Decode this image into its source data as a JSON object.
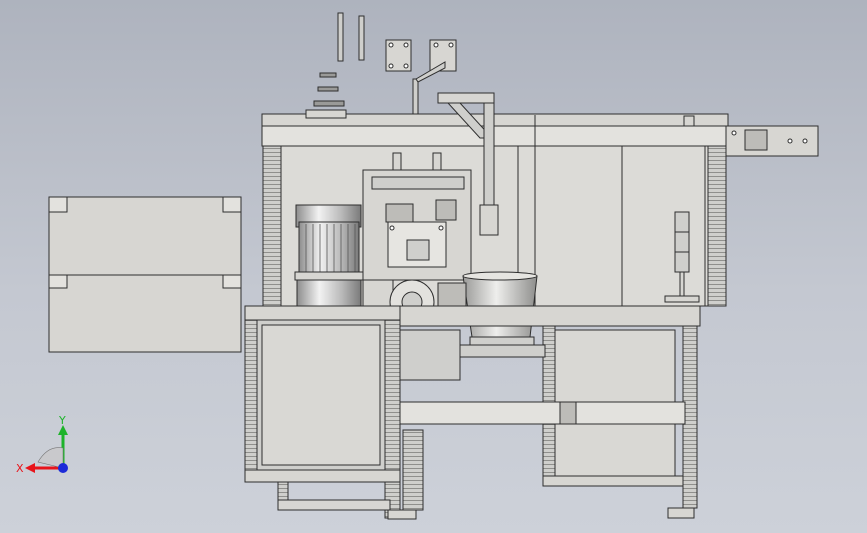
{
  "viewport": {
    "background_top": "#aeb3be",
    "background_bottom": "#cdd1d9",
    "model_edge_color": "#2e2e2e",
    "model_face_color": "#d7d6d2"
  },
  "triad": {
    "x_label": "X",
    "y_label": "Y",
    "x_color": "#e8141b",
    "y_color": "#1db32a",
    "z_color": "#1c2bd8",
    "origin_icon": "sphere-origin"
  }
}
